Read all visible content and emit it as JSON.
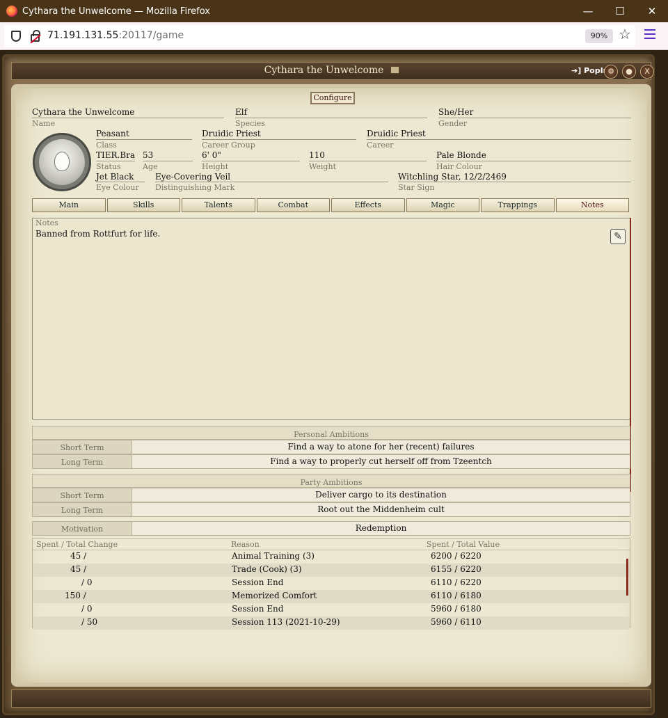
{
  "browser": {
    "window_title": "Cythara the Unwelcome — Mozilla Firefox",
    "url_host": "71.191.131.55",
    "url_rest": ":20117/game",
    "zoom": "90%",
    "minimize_glyph": "—",
    "maximize_glyph": "☐",
    "close_glyph": "✕",
    "star_glyph": "☆"
  },
  "sheet": {
    "title": "Cythara the Unwelcome",
    "popin_label": "➔] PopIn!",
    "settings_glyph": "⚙",
    "user_glyph": "●",
    "close_label": "X",
    "configure_label": "Configure"
  },
  "fields": {
    "name": {
      "value": "Cythara the Unwelcome",
      "label": "Name"
    },
    "species": {
      "value": "Elf",
      "label": "Species"
    },
    "gender": {
      "value": "She/Her",
      "label": "Gender"
    },
    "class": {
      "value": "Peasant",
      "label": "Class"
    },
    "career_group": {
      "value": "Druidic Priest",
      "label": "Career Group"
    },
    "career": {
      "value": "Druidic Priest",
      "label": "Career"
    },
    "status": {
      "value": "TIER.Bra",
      "label": "Status"
    },
    "age": {
      "value": "53",
      "label": "Age"
    },
    "height": {
      "value": "6' 0\"",
      "label": "Height"
    },
    "weight": {
      "value": "110",
      "label": "Weight"
    },
    "hair_colour": {
      "value": "Pale Blonde",
      "label": "Hair Colour"
    },
    "eye_colour": {
      "value": "Jet Black",
      "label": "Eye Colour"
    },
    "distinguishing_mark": {
      "value": "Eye-Covering Veil",
      "label": "Distinguishing Mark"
    },
    "star_sign": {
      "value": "Witchling Star, 12/2/2469",
      "label": "Star Sign"
    }
  },
  "tabs": [
    "Main",
    "Skills",
    "Talents",
    "Combat",
    "Effects",
    "Magic",
    "Trappings",
    "Notes"
  ],
  "active_tab": "Notes",
  "notes": {
    "label": "Notes",
    "text": "Banned from Rottfurt for life.",
    "edit_glyph": "✎"
  },
  "personal_ambitions": {
    "heading": "Personal Ambitions",
    "short_label": "Short Term",
    "short_value": "Find a way to atone for her (recent) failures",
    "long_label": "Long Term",
    "long_value": "Find a way to properly cut herself off from Tzeentch"
  },
  "party_ambitions": {
    "heading": "Party Ambitions",
    "short_label": "Short Term",
    "short_value": "Deliver cargo to its destination",
    "long_label": "Long Term",
    "long_value": "Root out the Middenheim cult"
  },
  "motivation": {
    "label": "Motivation",
    "value": "Redemption"
  },
  "xp_log": {
    "headers": [
      "Spent / Total Change",
      "Reason",
      "Spent / Total Value"
    ],
    "rows": [
      {
        "change": "45 /",
        "reason": "Animal Training (3)",
        "value": "6200 / 6220"
      },
      {
        "change": "45 /",
        "reason": "Trade (Cook) (3)",
        "value": "6155 / 6220"
      },
      {
        "change": "/ 0",
        "reason": "Session End",
        "value": "6110 / 6220"
      },
      {
        "change": "150 /",
        "reason": "Memorized Comfort",
        "value": "6110 / 6180"
      },
      {
        "change": "/ 0",
        "reason": "Session End",
        "value": "5960 / 6180"
      },
      {
        "change": "/ 50",
        "reason": "Session 113 (2021-10-29)",
        "value": "5960 / 6110"
      }
    ]
  }
}
